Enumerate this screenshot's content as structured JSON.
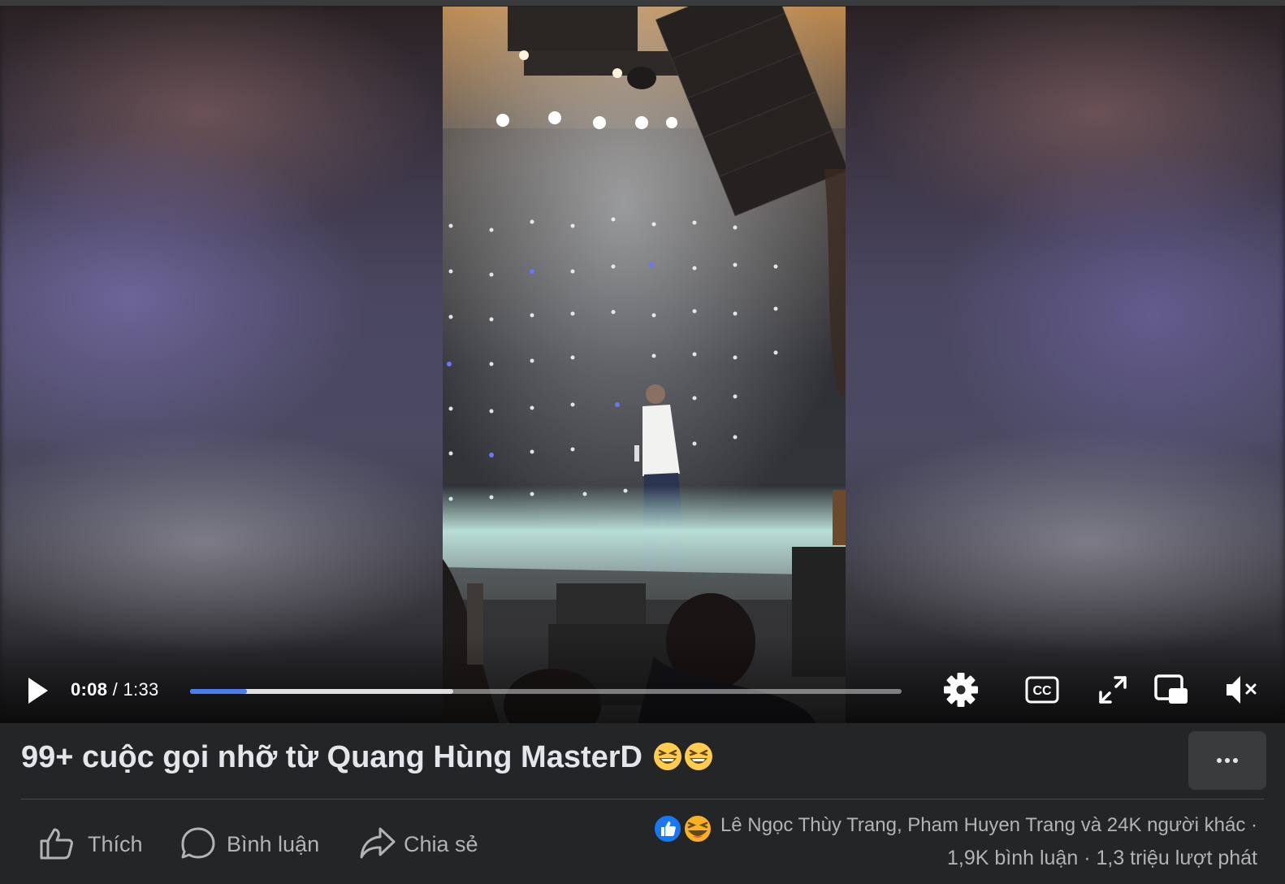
{
  "video": {
    "current_time": "0:08",
    "separator": "/",
    "duration": "1:33",
    "progress_played": 0.08,
    "progress_buffered": 0.37,
    "icons": [
      "play-icon",
      "settings-icon",
      "captions-icon",
      "fullscreen-icon",
      "picture-in-picture-icon",
      "volume-muted-icon"
    ]
  },
  "post": {
    "title": "99+ cuộc gọi nhỡ từ Quang Hùng MasterD",
    "title_emojis": [
      "laughing-emoji",
      "laughing-emoji"
    ],
    "more_icon": "more-dots-icon"
  },
  "actions": [
    {
      "label": "Thích",
      "icon": "like-icon"
    },
    {
      "label": "Bình luận",
      "icon": "comment-icon"
    },
    {
      "label": "Chia sẻ",
      "icon": "share-icon"
    }
  ],
  "reactions": {
    "icons": [
      "like-reaction-icon",
      "haha-reaction-icon"
    ],
    "people_text": "Lê Ngọc Thùy Trang, Pham Huyen Trang và 24K người khác",
    "dot": "·",
    "comments_text": "1,9K bình luận",
    "views_text": "1,3 triệu lượt phát"
  },
  "colors": {
    "background": "#242526",
    "progress_played": "#4a7df0",
    "like_blue": "#1877f2",
    "haha_yellow": "#f7b125"
  }
}
